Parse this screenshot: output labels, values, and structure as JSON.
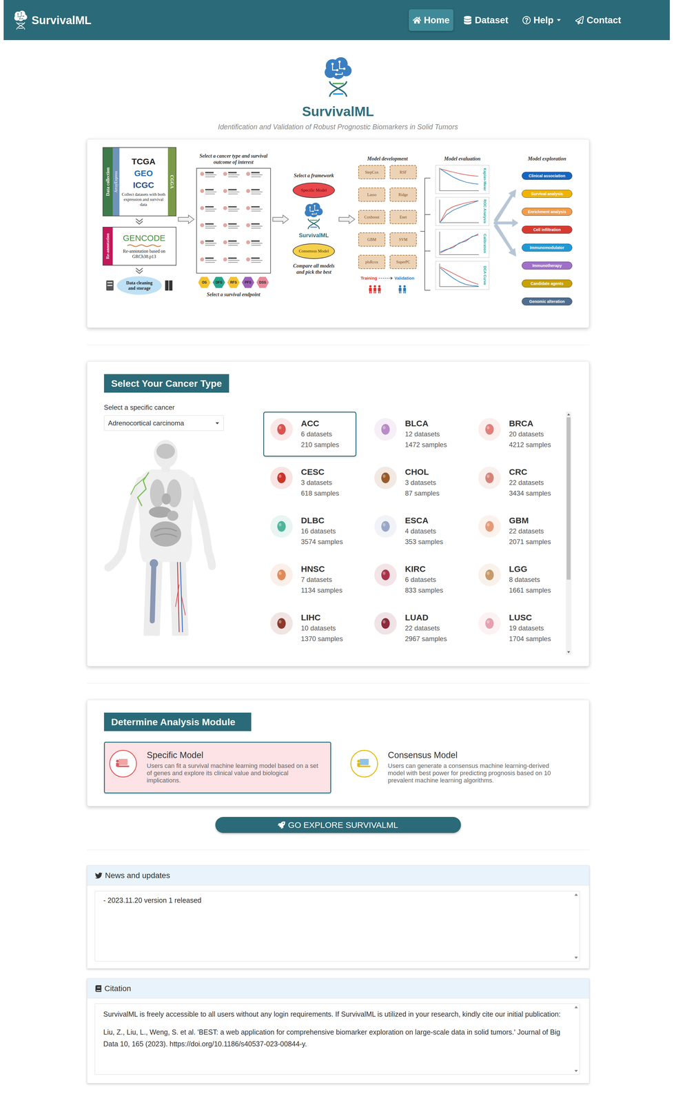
{
  "header": {
    "brand": "SurvivalML",
    "nav": [
      {
        "label": "Home",
        "selected": true,
        "icon": "home"
      },
      {
        "label": "Dataset",
        "selected": false,
        "icon": "database"
      },
      {
        "label": "Help",
        "selected": false,
        "icon": "help",
        "dropdown": true
      },
      {
        "label": "Contact",
        "selected": false,
        "icon": "send"
      }
    ]
  },
  "hero": {
    "title": "SurvivalML",
    "subtitle": "Identification and Validation of Robust Prognostic Biomarkers in Solid Tumors"
  },
  "workflow": {
    "collection": {
      "label": "Data collection",
      "sources": [
        "TCGA",
        "GEO",
        "ICGC"
      ],
      "side_left": "ArrayExpress",
      "side_right": "CGGA",
      "caption": "Collect datasets with both expression and survival data"
    },
    "annotation": {
      "label": "Re-annotation",
      "logo": "GENCODE",
      "caption": "Re-annotation based on GRCh38.p13"
    },
    "storage": "Data cleaning and storage",
    "select_title": "Select a cancer type and survival outcome of interest",
    "endpoints": [
      {
        "label": "OS",
        "color": "#f2c230"
      },
      {
        "label": "DFS",
        "color": "#2aa38a"
      },
      {
        "label": "RFS",
        "color": "#f2c230"
      },
      {
        "label": "PFS",
        "color": "#9c5fb5"
      },
      {
        "label": "DSS",
        "color": "#e8889a"
      }
    ],
    "endpoint_caption": "Select a survival endpoint",
    "framework_title": "Select a framework",
    "frameworks": [
      {
        "label": "Specific Model",
        "color": "#e8474c"
      },
      {
        "label": "Consensus Model",
        "color": "#f5d04a"
      }
    ],
    "framework_logo": "SurvivalML",
    "framework_caption": "Compare all models and pick the best",
    "development_title": "Model development",
    "models": [
      "StepCox",
      "RSF",
      "Lasso",
      "Ridge",
      "Coxboost",
      "Enet",
      "GBM",
      "SVM",
      "plsRcox",
      "SuperPC"
    ],
    "training": "Training",
    "validation": "Validation",
    "evaluation_title": "Model evaluation",
    "evaluations": [
      {
        "label": "Kaplan-Meier",
        "series": [
          [
            1,
            0.92,
            0.85,
            0.78,
            0.72,
            0.68,
            0.65
          ],
          [
            1,
            0.8,
            0.62,
            0.48,
            0.38,
            0.32,
            0.28
          ]
        ]
      },
      {
        "label": "ROC Analysis",
        "series": [
          [
            0,
            0.55,
            0.72,
            0.82,
            0.9,
            0.96,
            1
          ],
          [
            0,
            0.35,
            0.55,
            0.68,
            0.8,
            0.9,
            1
          ]
        ]
      },
      {
        "label": "Calibration",
        "series": [
          [
            0.05,
            0.2,
            0.35,
            0.5,
            0.65,
            0.8,
            0.95
          ],
          [
            0.1,
            0.22,
            0.3,
            0.52,
            0.6,
            0.82,
            0.9
          ]
        ]
      },
      {
        "label": "DCA Curve",
        "series": [
          [
            0.9,
            0.75,
            0.6,
            0.45,
            0.3,
            0.18,
            0.08
          ],
          [
            0.85,
            0.6,
            0.38,
            0.2,
            0.08,
            0.02,
            0
          ]
        ]
      }
    ],
    "exploration_title": "Model exploration",
    "explorations": [
      {
        "label": "Clinical association",
        "color": "#1565c0"
      },
      {
        "label": "Survival analysis",
        "color": "#f0b400"
      },
      {
        "label": "Enrichment analysis",
        "color": "#f39c4a"
      },
      {
        "label": "Cell infiltration",
        "color": "#d93a2f"
      },
      {
        "label": "Immunomodulator",
        "color": "#1e9bd7"
      },
      {
        "label": "Immunotherapy",
        "color": "#a070c8"
      },
      {
        "label": "Candidate agents",
        "color": "#c9a200"
      },
      {
        "label": "Genomic alteration",
        "color": "#4f6d8f"
      }
    ]
  },
  "cancer_panel": {
    "title": "Select Your Cancer Type",
    "select_label": "Select a specific cancer",
    "select_value": "Adrenocortical carcinoma",
    "cancers": [
      {
        "code": "ACC",
        "datasets": "6 datasets",
        "samples": "210 samples",
        "selected": true,
        "color": "#d9534f"
      },
      {
        "code": "BLCA",
        "datasets": "12 datasets",
        "samples": "1472 samples",
        "selected": false,
        "color": "#b98ac4"
      },
      {
        "code": "BRCA",
        "datasets": "20 datasets",
        "samples": "4212 samples",
        "selected": false,
        "color": "#e0807a"
      },
      {
        "code": "CESC",
        "datasets": "3 datasets",
        "samples": "618 samples",
        "selected": false,
        "color": "#c9342b"
      },
      {
        "code": "CHOL",
        "datasets": "3 datasets",
        "samples": "87 samples",
        "selected": false,
        "color": "#9a5a2b"
      },
      {
        "code": "CRC",
        "datasets": "22 datasets",
        "samples": "3434 samples",
        "selected": false,
        "color": "#d4857a"
      },
      {
        "code": "DLBC",
        "datasets": "16 datasets",
        "samples": "3574 samples",
        "selected": false,
        "color": "#4fb59a"
      },
      {
        "code": "ESCA",
        "datasets": "4 datasets",
        "samples": "353 samples",
        "selected": false,
        "color": "#9aa8c8"
      },
      {
        "code": "GBM",
        "datasets": "22 datasets",
        "samples": "2071 samples",
        "selected": false,
        "color": "#e59a7a"
      },
      {
        "code": "HNSC",
        "datasets": "7 datasets",
        "samples": "1134 samples",
        "selected": false,
        "color": "#e08a5a"
      },
      {
        "code": "KIRC",
        "datasets": "6 datasets",
        "samples": "833 samples",
        "selected": false,
        "color": "#a8344a"
      },
      {
        "code": "LGG",
        "datasets": "8 datasets",
        "samples": "1661 samples",
        "selected": false,
        "color": "#c79a6a"
      },
      {
        "code": "LIHC",
        "datasets": "10 datasets",
        "samples": "1370 samples",
        "selected": false,
        "color": "#8b3a2a"
      },
      {
        "code": "LUAD",
        "datasets": "22 datasets",
        "samples": "2967 samples",
        "selected": false,
        "color": "#8b2a3a"
      },
      {
        "code": "LUSC",
        "datasets": "19 datasets",
        "samples": "1704 samples",
        "selected": false,
        "color": "#e6a0b0"
      }
    ],
    "scrollbar": {
      "level": 0.7
    }
  },
  "module_panel": {
    "title": "Determine Analysis Module",
    "modules": [
      {
        "name": "Specific Model",
        "description": "Users can fit a survival machine learning model based on a set of genes and explore its clinical value and biological implications.",
        "selected": true
      },
      {
        "name": "Consensus Model",
        "description": "Users can generate a consensus machine learning-derived model with best power for predicting prognosis based on 10 prevalent machine learning algorithms.",
        "selected": false
      }
    ]
  },
  "explore_button": "GO EXPLORE SURVIVALML",
  "news": {
    "title": "News and updates",
    "items": [
      "- 2023.11.20 version 1 released"
    ]
  },
  "citation": {
    "title": "Citation",
    "paragraphs": [
      "SurvivalML is freely accessible to all users without any login requirements. If SurvivalML is utilized in your research, kindly cite our initial publication:",
      "Liu, Z., Liu, L., Weng, S. et al. 'BEST: a web application for comprehensive biomarker exploration on large-scale data in solid tumors.' Journal of Big Data 10, 165 (2023). https://doi.org/10.1186/s40537-023-00844-y."
    ]
  }
}
